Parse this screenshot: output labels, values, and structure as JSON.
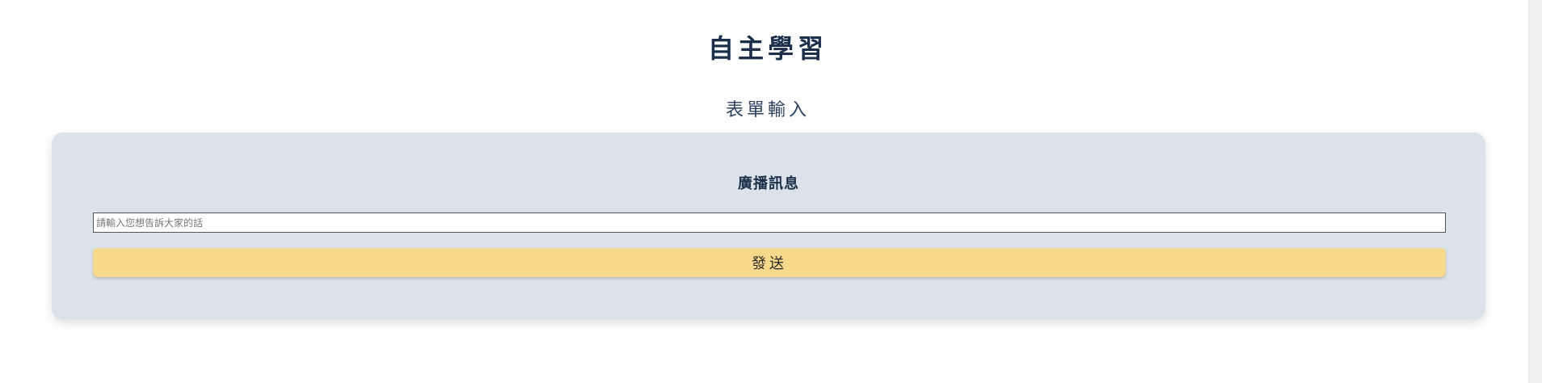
{
  "page": {
    "title": "自主學習",
    "section_title": "表單輸入"
  },
  "form": {
    "title": "廣播訊息",
    "message_input": {
      "value": "",
      "placeholder": "請輸入您想告訴大家的話"
    },
    "send_label": "發送"
  },
  "colors": {
    "title_text": "#1b2f4a",
    "card_background": "#dbe2ea",
    "button_background": "#f8d98b"
  }
}
